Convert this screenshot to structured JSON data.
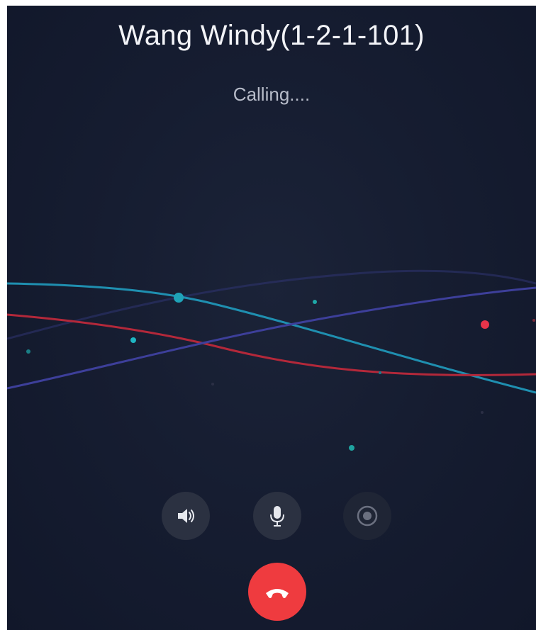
{
  "call": {
    "contact_name": "Wang Windy(1-2-1-101)",
    "status": "Calling...."
  },
  "controls": {
    "speaker_icon": "speaker-icon",
    "mic_icon": "microphone-icon",
    "record_icon": "record-icon",
    "hangup_icon": "hang-up-phone-icon"
  },
  "colors": {
    "background": "#141a2e",
    "hangup": "#ef3b3f",
    "wave_cyan": "#1f8fb0",
    "wave_red": "#b3283a",
    "wave_purple": "#3d3f9a"
  }
}
